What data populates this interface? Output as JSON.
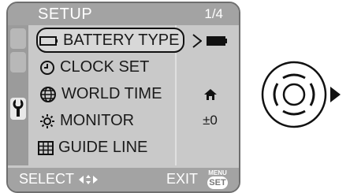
{
  "menu": {
    "title": "SETUP",
    "page_indicator": "1/4",
    "items": [
      {
        "label": "BATTERY TYPE",
        "icon": "battery-icon",
        "value_icon": "battery-icon",
        "selected": true
      },
      {
        "label": "CLOCK SET",
        "icon": "clock-icon",
        "value": ""
      },
      {
        "label": "WORLD TIME",
        "icon": "globe-icon",
        "value_icon": "home-icon"
      },
      {
        "label": "MONITOR",
        "icon": "sun-icon",
        "value": "±0"
      },
      {
        "label": "GUIDE LINE",
        "icon": "grid-icon",
        "value": ""
      }
    ],
    "active_tab_icon": "wrench-icon"
  },
  "footer": {
    "select_label": "SELECT",
    "exit_label": "EXIT",
    "menu_label": "MENU",
    "set_label": "SET"
  },
  "controls": {
    "dpad_icon": "dpad-icon",
    "arrow_icon": "right-arrow-icon"
  },
  "colors": {
    "background": "#c9c9c9",
    "bar": "#a3a3a3",
    "text": "#1a1a1a"
  }
}
